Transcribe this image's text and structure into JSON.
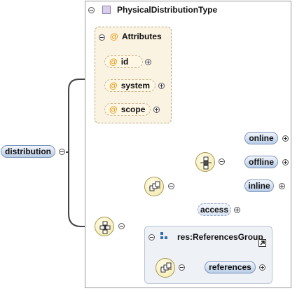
{
  "complex_type": {
    "title": "PhysicalDistributionType"
  },
  "attributes": {
    "heading": "Attributes",
    "at_symbol": "@",
    "items": [
      {
        "label": "id"
      },
      {
        "label": "system"
      },
      {
        "label": "scope"
      }
    ]
  },
  "root_element": {
    "label": "distribution"
  },
  "choice_elements": [
    {
      "label": "online"
    },
    {
      "label": "offline"
    },
    {
      "label": "inline"
    }
  ],
  "optional_element": {
    "label": "access"
  },
  "group": {
    "title": "res:ReferencesGroup",
    "element": "references"
  },
  "colors": {
    "element_fill": "#b9cde8",
    "attribute_box": "#fbf3e2",
    "attribute_at": "#e6a020",
    "group_box": "#eef2f7",
    "compositor_fill": "#f3e7a6"
  },
  "icons": [
    "minus-toggle-icon",
    "plus-toggle-icon",
    "complex-type-icon",
    "sequence-icon",
    "choice-icon",
    "group-icon",
    "link-arrow-icon"
  ]
}
